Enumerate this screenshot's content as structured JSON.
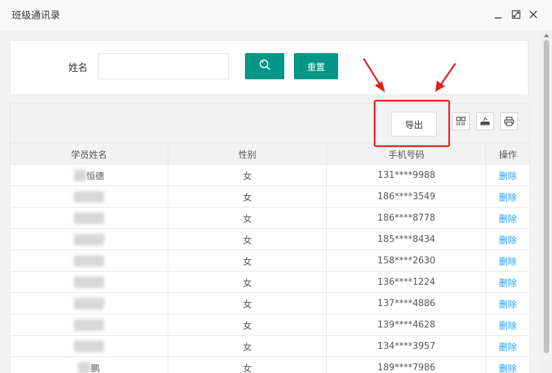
{
  "window": {
    "title": "班级通讯录",
    "minimize_icon": "minimize-icon",
    "maximize_icon": "maximize-icon",
    "close_icon": "close-icon"
  },
  "search": {
    "label": "姓名",
    "value": "",
    "placeholder": "",
    "search_icon": "search-icon",
    "reset_label": "重置"
  },
  "toolbar": {
    "export_label": "导出",
    "columns_icon": "columns-grid-icon",
    "import_icon": "import-icon",
    "print_icon": "print-icon"
  },
  "table": {
    "headers": [
      "学员姓名",
      "性别",
      "手机号码",
      "操作"
    ],
    "rows": [
      {
        "name": "恒德",
        "gender": "女",
        "phone": "131****9988",
        "action": "删除"
      },
      {
        "name": "",
        "gender": "女",
        "phone": "186****3549",
        "action": "删除"
      },
      {
        "name": "",
        "gender": "女",
        "phone": "186****8778",
        "action": "删除"
      },
      {
        "name": "",
        "gender": "女",
        "phone": "185****8434",
        "action": "删除"
      },
      {
        "name": "",
        "gender": "女",
        "phone": "158****2630",
        "action": "删除"
      },
      {
        "name": "",
        "gender": "女",
        "phone": "136****1224",
        "action": "删除"
      },
      {
        "name": "",
        "gender": "女",
        "phone": "137****4886",
        "action": "删除"
      },
      {
        "name": "",
        "gender": "女",
        "phone": "139****4628",
        "action": "删除"
      },
      {
        "name": "",
        "gender": "女",
        "phone": "134****3957",
        "action": "删除"
      },
      {
        "name": "鹏",
        "gender": "女",
        "phone": "189****7986",
        "action": "删除"
      }
    ]
  },
  "colors": {
    "primary": "#009688",
    "link": "#1e9fff",
    "annotation": "#e02020"
  }
}
